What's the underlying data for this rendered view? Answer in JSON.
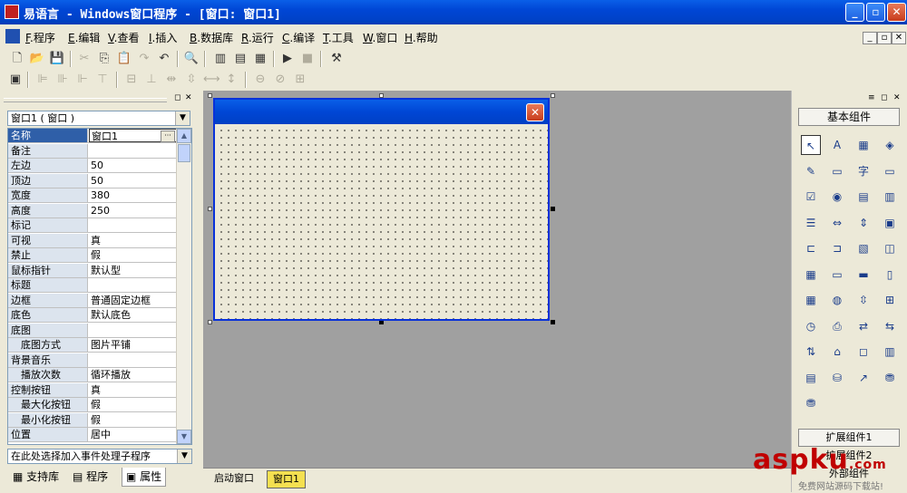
{
  "titlebar": {
    "title": "易语言 - Windows窗口程序 - [窗口: 窗口1]",
    "min": "_",
    "max": "▫",
    "close": "✕"
  },
  "menu": {
    "items": [
      {
        "key": "F",
        "label": "程序"
      },
      {
        "key": "E",
        "label": "编辑"
      },
      {
        "key": "V",
        "label": "查看"
      },
      {
        "key": "I",
        "label": "插入"
      },
      {
        "key": "B",
        "label": "数据库"
      },
      {
        "key": "R",
        "label": "运行"
      },
      {
        "key": "C",
        "label": "编译"
      },
      {
        "key": "T",
        "label": "工具"
      },
      {
        "key": "W",
        "label": "窗口"
      },
      {
        "key": "H",
        "label": "帮助"
      }
    ],
    "mdi_buttons": [
      "_",
      "▫",
      "✕"
    ]
  },
  "toolbar1": {
    "icons": [
      "new-icon",
      "open-icon",
      "save-icon",
      "cut-icon",
      "copy-icon",
      "paste-icon",
      "redo-icon",
      "undo-icon",
      "find-icon",
      "layout1-icon",
      "layout2-icon",
      "layout3-icon",
      "run-icon",
      "stop-icon",
      "debug-icon"
    ]
  },
  "left_panel": {
    "object_selector": "窗口1 ( 窗口 )",
    "properties": [
      {
        "name": "名称",
        "value": "窗口1",
        "selected": true
      },
      {
        "name": "备注",
        "value": ""
      },
      {
        "name": "左边",
        "value": "50"
      },
      {
        "name": "顶边",
        "value": "50"
      },
      {
        "name": "宽度",
        "value": "380"
      },
      {
        "name": "高度",
        "value": "250"
      },
      {
        "name": "标记",
        "value": ""
      },
      {
        "name": "可视",
        "value": "真"
      },
      {
        "name": "禁止",
        "value": "假"
      },
      {
        "name": "鼠标指针",
        "value": "默认型"
      },
      {
        "name": "标题",
        "value": ""
      },
      {
        "name": "边框",
        "value": "普通固定边框"
      },
      {
        "name": "底色",
        "value": "默认底色"
      },
      {
        "name": "底图",
        "value": ""
      },
      {
        "name": "底图方式",
        "value": "图片平铺",
        "sub": true
      },
      {
        "name": "背景音乐",
        "value": ""
      },
      {
        "name": "播放次数",
        "value": "循环播放",
        "sub": true
      },
      {
        "name": "控制按钮",
        "value": "真"
      },
      {
        "name": "最大化按钮",
        "value": "假",
        "sub": true
      },
      {
        "name": "最小化按钮",
        "value": "假",
        "sub": true
      },
      {
        "name": "位置",
        "value": "居中"
      }
    ],
    "event_selector": "在此处选择加入事件处理子程序",
    "tabs": [
      {
        "label": "支持库"
      },
      {
        "label": "程序"
      },
      {
        "label": "属性",
        "active": true
      }
    ]
  },
  "form": {
    "close": "✕"
  },
  "right_panel": {
    "basic_components_label": "基本组件",
    "extension_label": "扩展组件1",
    "ext2": "扩展组件2",
    "ext3": "外部组件",
    "components": [
      {
        "icon": "pointer-icon",
        "glyph": "↖"
      },
      {
        "icon": "label-icon",
        "glyph": "A"
      },
      {
        "icon": "picture-icon",
        "glyph": "▦"
      },
      {
        "icon": "shape-icon",
        "glyph": "◈"
      },
      {
        "icon": "edit-icon",
        "glyph": "✎"
      },
      {
        "icon": "checkbox-label-icon",
        "glyph": "▭"
      },
      {
        "icon": "text-icon",
        "glyph": "字"
      },
      {
        "icon": "button-icon",
        "glyph": "▭"
      },
      {
        "icon": "checkbox-icon",
        "glyph": "☑"
      },
      {
        "icon": "radio-icon",
        "glyph": "◉"
      },
      {
        "icon": "listbox-icon",
        "glyph": "▤"
      },
      {
        "icon": "grid-icon",
        "glyph": "▥"
      },
      {
        "icon": "list-icon",
        "glyph": "☰"
      },
      {
        "icon": "hscroll-icon",
        "glyph": "⇔"
      },
      {
        "icon": "vscroll-icon",
        "glyph": "⇕"
      },
      {
        "icon": "frame-icon",
        "glyph": "▣"
      },
      {
        "icon": "tab-icon",
        "glyph": "⊏"
      },
      {
        "icon": "panel-icon",
        "glyph": "⊐"
      },
      {
        "icon": "image-list-icon",
        "glyph": "▧"
      },
      {
        "icon": "timer-icon",
        "glyph": "◫"
      },
      {
        "icon": "table-icon",
        "glyph": "▦"
      },
      {
        "icon": "combo-icon",
        "glyph": "▭"
      },
      {
        "icon": "dir-icon",
        "glyph": "▬"
      },
      {
        "icon": "file-icon",
        "glyph": "▯"
      },
      {
        "icon": "chart-grid-icon",
        "glyph": "▦"
      },
      {
        "icon": "network-icon",
        "glyph": "◍"
      },
      {
        "icon": "splitter-icon",
        "glyph": "⇳"
      },
      {
        "icon": "tree-icon",
        "glyph": "⊞"
      },
      {
        "icon": "clock-icon",
        "glyph": "◷"
      },
      {
        "icon": "printer-icon",
        "glyph": "⎙"
      },
      {
        "icon": "sync-icon",
        "glyph": "⇄"
      },
      {
        "icon": "sync2-icon",
        "glyph": "⇆"
      },
      {
        "icon": "client-icon",
        "glyph": "⇅"
      },
      {
        "icon": "server-icon",
        "glyph": "⌂"
      },
      {
        "icon": "window-icon",
        "glyph": "◻"
      },
      {
        "icon": "db-window-icon",
        "glyph": "▥"
      },
      {
        "icon": "db-list-icon",
        "glyph": "▤"
      },
      {
        "icon": "db-icon",
        "glyph": "⛁"
      },
      {
        "icon": "graph-icon",
        "glyph": "↗"
      },
      {
        "icon": "odbc-icon",
        "glyph": "⛃"
      },
      {
        "icon": "odbc2-icon",
        "glyph": "⛃"
      }
    ]
  },
  "bottom_tabs": [
    {
      "label": "启动窗口"
    },
    {
      "label": "窗口1",
      "active": true
    }
  ],
  "watermark": {
    "brand": "aspku",
    "tld": ".com",
    "sub": "免费网站源码下载站!"
  }
}
